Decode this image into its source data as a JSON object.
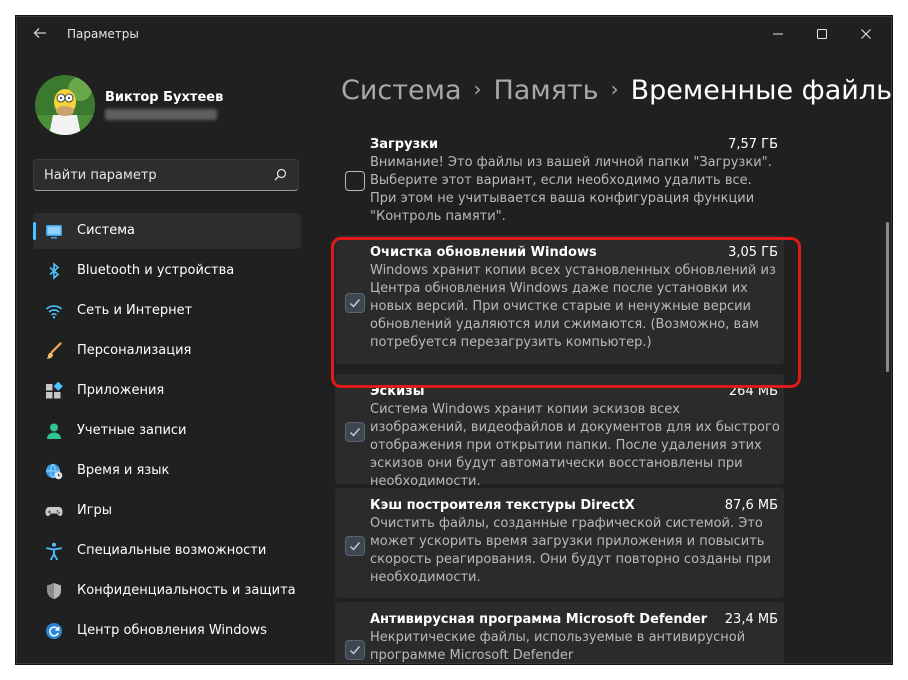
{
  "window": {
    "title": "Параметры",
    "back_icon": "back-arrow-icon",
    "controls": [
      "minimize-icon",
      "maximize-icon",
      "close-icon"
    ]
  },
  "user": {
    "name": "Виктор Бухтеев",
    "avatar_icon": "user-avatar"
  },
  "search": {
    "placeholder": "Найти параметр",
    "icon": "search-icon"
  },
  "nav": [
    {
      "label": "Система",
      "icon": "system-icon",
      "active": true
    },
    {
      "label": "Bluetooth и устройства",
      "icon": "bluetooth-icon"
    },
    {
      "label": "Сеть и Интернет",
      "icon": "wifi-icon"
    },
    {
      "label": "Персонализация",
      "icon": "brush-icon"
    },
    {
      "label": "Приложения",
      "icon": "apps-icon"
    },
    {
      "label": "Учетные записи",
      "icon": "account-icon"
    },
    {
      "label": "Время и язык",
      "icon": "globe-clock-icon"
    },
    {
      "label": "Игры",
      "icon": "gamepad-icon"
    },
    {
      "label": "Специальные возможности",
      "icon": "accessibility-icon"
    },
    {
      "label": "Конфиденциальность и защита",
      "icon": "shield-icon"
    },
    {
      "label": "Центр обновления Windows",
      "icon": "update-icon"
    }
  ],
  "breadcrumb": {
    "items": [
      "Система",
      "Память"
    ],
    "separator": "›",
    "current": "Временные файлы"
  },
  "accent_color": "#4cc2ff",
  "highlight_color": "#e01919",
  "cards": [
    {
      "title": "Загрузки",
      "size": "7,57 ГБ",
      "checked": false,
      "description": "Внимание! Это файлы из вашей личной папки \"Загрузки\". Выберите этот вариант, если необходимо удалить все. При этом не учитывается ваша конфигурация функции \"Контроль памяти\"."
    },
    {
      "title": "Очистка обновлений Windows",
      "size": "3,05 ГБ",
      "checked": true,
      "highlighted": true,
      "description": "Windows хранит копии всех установленных обновлений из Центра обновления Windows даже после установки их новых версий. При очистке старые и ненужные версии обновлений удаляются или сжимаются. (Возможно, вам потребуется перезагрузить компьютер.)"
    },
    {
      "title": "Эскизы",
      "size": "264 МБ",
      "checked": true,
      "description": "Система Windows хранит копии эскизов всех изображений, видеофайлов и документов для их быстрого отображения при открытии папки. После удаления этих эскизов они будут автоматически восстановлены при необходимости."
    },
    {
      "title": "Кэш построителя текстуры DirectX",
      "size": "87,6 МБ",
      "checked": true,
      "description": "Очистить файлы, созданные графической системой. Это может ускорить время загрузки приложения и повысить скорость реагирования. Они будут повторно созданы при необходимости."
    },
    {
      "title": "Антивирусная программа Microsoft Defender",
      "size": "23,4 МБ",
      "checked": true,
      "description": "Некритические файлы, используемые в антивирусной программе Microsoft Defender"
    }
  ]
}
